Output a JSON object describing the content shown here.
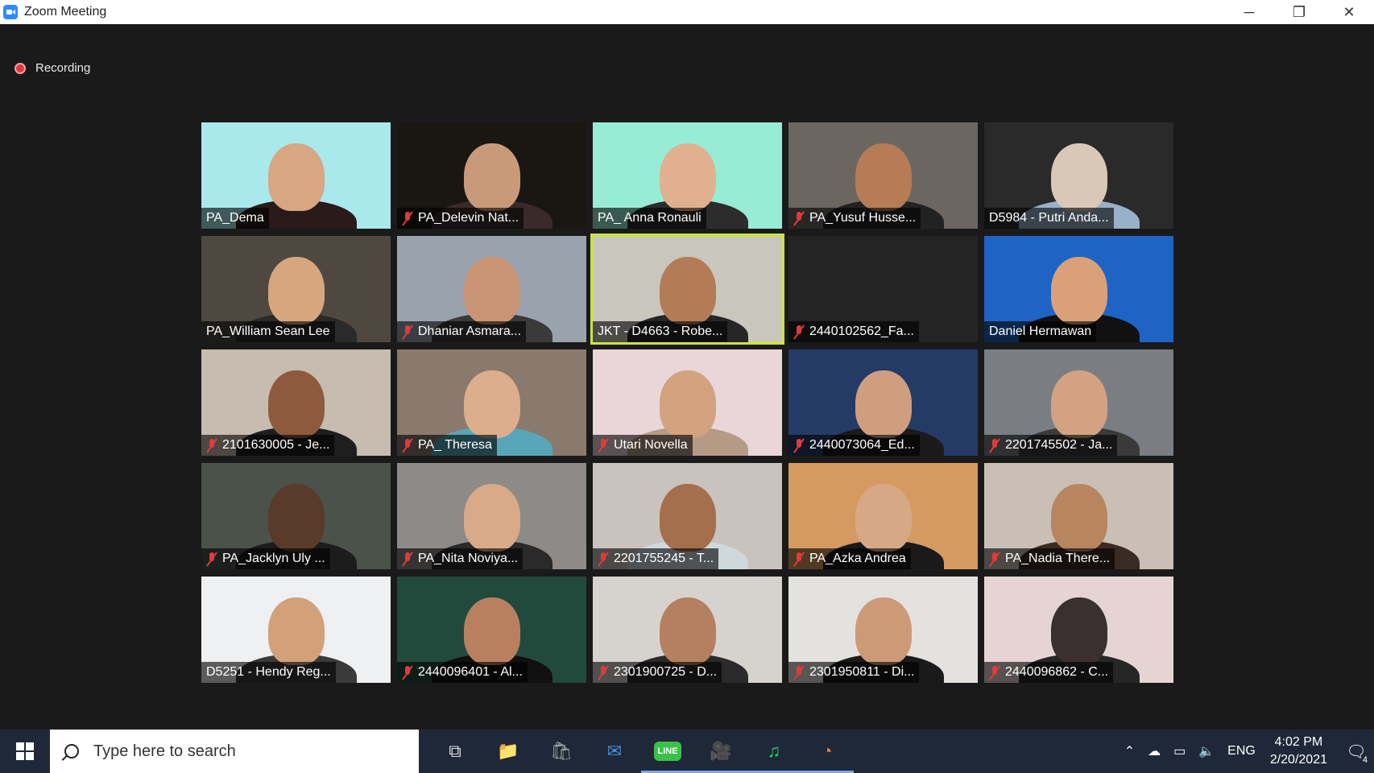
{
  "window": {
    "title": "Zoom Meeting",
    "controls": [
      "─",
      "❐",
      "✕"
    ]
  },
  "recording": {
    "label": "Recording",
    "color": "#e23b3b"
  },
  "participants": [
    {
      "name": "PA_Dema",
      "muted": false,
      "bg": "#a9e9ec",
      "skin": "#d8a682",
      "shirt": "#2a1a1a"
    },
    {
      "name": "PA_Delevin Nat...",
      "muted": true,
      "bg": "#1a1612",
      "skin": "#c89a7a",
      "shirt": "#3a2a2a"
    },
    {
      "name": "PA_ Anna Ronauli",
      "muted": false,
      "bg": "#98ecd6",
      "skin": "#e0b090",
      "shirt": "#2c2c2c"
    },
    {
      "name": "PA_Yusuf Husse...",
      "muted": true,
      "bg": "#6b6660",
      "skin": "#b57c55",
      "shirt": "#222222"
    },
    {
      "name": "D5984 - Putri Anda...",
      "muted": false,
      "bg": "#2a2a2a",
      "skin": "#d9c7b8",
      "shirt": "#98b0c8"
    },
    {
      "name": "PA_William Sean Lee",
      "muted": false,
      "bg": "#4e4840",
      "skin": "#d6a77f",
      "shirt": "#2a2a2a"
    },
    {
      "name": "Dhaniar Asmara...",
      "muted": true,
      "bg": "#9aa3ad",
      "skin": "#c99574",
      "shirt": "#3a3a3a"
    },
    {
      "name": "JKT - D4663 - Robe...",
      "muted": false,
      "bg": "#c9c6bd",
      "skin": "#b37c57",
      "shirt": "#262626"
    },
    {
      "name": "2440102562_Fa...",
      "muted": true,
      "bg": "#242424",
      "skin": "",
      "shirt": ""
    },
    {
      "name": "Daniel Hermawan",
      "muted": false,
      "bg": "#1f64c4",
      "skin": "#d9a07a",
      "shirt": "#111111"
    },
    {
      "name": "2101630005 - Je...",
      "muted": true,
      "bg": "#c7bcb0",
      "skin": "#8e5a3e",
      "shirt": "#1e1e1e"
    },
    {
      "name": "PA_ Theresa",
      "muted": true,
      "bg": "#8a7a6e",
      "skin": "#dcae8c",
      "shirt": "#58a6b8"
    },
    {
      "name": "Utari Novella",
      "muted": true,
      "bg": "#e9d6d9",
      "skin": "#d3a27f",
      "shirt": "#b59b86"
    },
    {
      "name": "2440073064_Ed...",
      "muted": true,
      "bg": "#263a66",
      "skin": "#cf9e7e",
      "shirt": "#1a1a1a"
    },
    {
      "name": "2201745502 - Ja...",
      "muted": true,
      "bg": "#7a7e82",
      "skin": "#d3a282",
      "shirt": "#3a3a3a"
    },
    {
      "name": "PA_Jacklyn Uly ...",
      "muted": true,
      "bg": "#4a524a",
      "skin": "#5a3a2a",
      "shirt": "#1c1c1c"
    },
    {
      "name": "PA_Nita Noviya...",
      "muted": true,
      "bg": "#8d8a87",
      "skin": "#d9aa88",
      "shirt": "#2a2a2a"
    },
    {
      "name": "2201755245 - T...",
      "muted": true,
      "bg": "#c9c2bd",
      "skin": "#a56e4c",
      "shirt": "#cfd8dc"
    },
    {
      "name": "PA_Azka Andrea",
      "muted": true,
      "bg": "#d59a60",
      "skin": "#d7a886",
      "shirt": "#1a1a1a"
    },
    {
      "name": "PA_Nadia There...",
      "muted": true,
      "bg": "#c9bfb5",
      "skin": "#b98460",
      "shirt": "#3a2c22"
    },
    {
      "name": "D5251 - Hendy Reg...",
      "muted": false,
      "bg": "#eef0f2",
      "skin": "#d4a07a",
      "shirt": "#3a3a3a"
    },
    {
      "name": "2440096401 - Al...",
      "muted": true,
      "bg": "#214a3c",
      "skin": "#b98060",
      "shirt": "#111111"
    },
    {
      "name": "2301900725 - D...",
      "muted": true,
      "bg": "#d6d3cf",
      "skin": "#b48060",
      "shirt": "#2a2a2a"
    },
    {
      "name": "2301950811 - Di...",
      "muted": true,
      "bg": "#e4e2df",
      "skin": "#cd9a78",
      "shirt": "#1a1a1a"
    },
    {
      "name": "2440096862 - C...",
      "muted": true,
      "bg": "#e6d4d4",
      "skin": "#3a3030",
      "shirt": "#262626"
    }
  ],
  "active_speaker_index": 7,
  "taskbar": {
    "search_placeholder": "Type here to search",
    "apps": [
      {
        "icon": "task-view-icon",
        "glyph": "⧉"
      },
      {
        "icon": "file-explorer-icon",
        "glyph": "📁"
      },
      {
        "icon": "microsoft-store-icon",
        "glyph": "🛍"
      },
      {
        "icon": "mail-icon",
        "glyph": "✉"
      },
      {
        "icon": "line-app-icon",
        "glyph": "LINE"
      },
      {
        "icon": "zoom-app-icon",
        "glyph": "🎥"
      },
      {
        "icon": "spotify-icon",
        "glyph": "♫"
      },
      {
        "icon": "timer-app-icon",
        "glyph": "◔"
      }
    ],
    "language": "ENG",
    "time": "4:02 PM",
    "date": "2/20/2021",
    "notification_count": "4"
  }
}
